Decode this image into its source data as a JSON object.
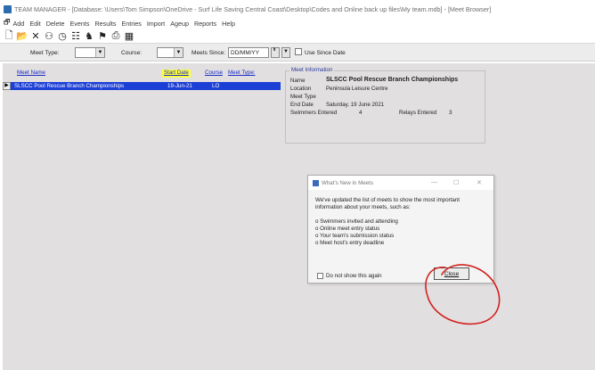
{
  "window": {
    "title": "TEAM MANAGER - [Database: \\Users\\Tom Simpson\\OneDrive - Surf Life Saving Central Coast\\Desktop\\Codes and Online back up files\\My team.mdb] - [Meet Browser]"
  },
  "menu": {
    "items": [
      "Add",
      "Edit",
      "Delete",
      "Events",
      "Results",
      "Entries",
      "Import",
      "Ageup",
      "Reports",
      "Help"
    ]
  },
  "toolbar": {
    "icons": [
      "new-document-icon",
      "open-folder-icon",
      "delete-x-icon",
      "people-icon",
      "clock-icon",
      "list-icon",
      "swimmer-icon",
      "medal-icon",
      "printer-icon",
      "calendar-icon"
    ]
  },
  "filters": {
    "meet_type_label": "Meet Type:",
    "meet_type_value": "",
    "course_label": "Course:",
    "course_value": "",
    "meets_since_label": "Meets Since:",
    "meets_since_value": "DD/MM/YY",
    "use_since_date_label": "Use Since Date",
    "use_since_date_checked": false
  },
  "grid": {
    "headers": {
      "meet_name": "Meet Name",
      "start_date": "Start Date",
      "course": "Course",
      "meet_type": "Meet Type:"
    },
    "rows": [
      {
        "meet_name": "SLSCC Pool Rescue Branch Championships",
        "start_date": "19-Jun-21",
        "course": "LO",
        "meet_type": ""
      }
    ]
  },
  "meet_info": {
    "title": "Meet Information",
    "name_label": "Name",
    "name_value": "SLSCC Pool Rescue Branch Championships",
    "location_label": "Location",
    "location_value": "Peninsula Leisure Centre",
    "meet_type_label": "Meet Type",
    "meet_type_value": "",
    "end_date_label": "End Date",
    "end_date_value": "Saturday, 19 June 2021",
    "swimmers_label": "Swimmers Entered",
    "swimmers_value": "4",
    "relays_label": "Relays Entered",
    "relays_value": "3"
  },
  "dialog": {
    "title": "What's New in Meets",
    "minimize": "—",
    "maximize": "☐",
    "close_x": "✕",
    "intro_line1": "We've updated the list of meets to show the most important",
    "intro_line2": "information about your meets, such as:",
    "bullets": [
      "o Swimmers invited and attending",
      "o Online meet entry status",
      "o Your team's submission status",
      "o Meet host's entry deadline"
    ],
    "dont_show_label": "Do not show this again",
    "dont_show_checked": false,
    "close_button_label": "Close"
  },
  "colors": {
    "selection": "#1c3fd6",
    "link": "#1a2bc8",
    "sort_highlight": "#ffff3c",
    "panel_bg": "#e2dfe0",
    "annotation": "#d2221f"
  }
}
